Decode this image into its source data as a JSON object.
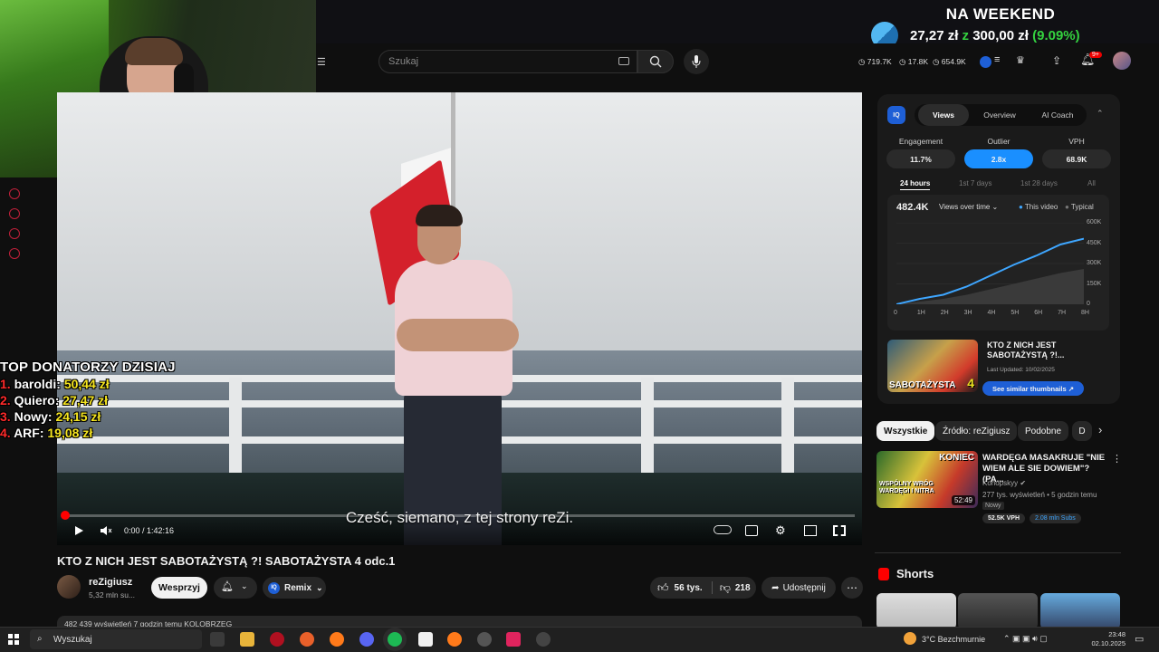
{
  "donation_goal": {
    "title": "NA WEEKEND",
    "amount": "27,27 zł",
    "connector": "z",
    "target": "300,00 zł",
    "percent": "(9.09%)"
  },
  "header": {
    "search_placeholder": "Szukaj",
    "stats": [
      "719.7K",
      "17.8K",
      "654.9K"
    ],
    "notification_count": "9+"
  },
  "donors": {
    "title": "TOP DONATORZY DZISIAJ",
    "list": [
      {
        "rank": "1.",
        "name": "baroldi:",
        "amount": "50,44 zł"
      },
      {
        "rank": "2.",
        "name": "Quiero:",
        "amount": "27,47 zł"
      },
      {
        "rank": "3.",
        "name": "Nowy:",
        "amount": "24,15 zł"
      },
      {
        "rank": "4.",
        "name": "ARF:",
        "amount": "19,08 zł"
      }
    ]
  },
  "player": {
    "subtitle": "Cześć, siemano, z tej strony reZi.",
    "time": "0:00 / 1:42:16",
    "progress": 0.0
  },
  "video": {
    "title": "KTO Z NICH JEST SABOTAŻYSTĄ ?! SABOTAŻYSTA 4 odc.1",
    "channel": "reZigiusz",
    "subscribers": "5,32 mln su...",
    "support_label": "Wesprzyj",
    "remix_label": "Remix",
    "likes": "56 tys.",
    "dislikes": "218",
    "share_label": "Udostępnij",
    "description_preview": "482 439 wyświetleń  7 godzin temu  KOLOBRZEG"
  },
  "vidiq": {
    "logo": "IQ",
    "tabs": [
      "Views",
      "Overview",
      "AI Coach"
    ],
    "active_tab": "Views",
    "metrics": [
      {
        "label": "Engagement",
        "value": "11.7%"
      },
      {
        "label": "Outlier",
        "value": "2.8x"
      },
      {
        "label": "VPH",
        "value": "68.9K"
      }
    ],
    "periods": [
      "24 hours",
      "1st 7 days",
      "1st 28 days",
      "All"
    ],
    "views_total": "482.4K",
    "views_selector": "Views over time",
    "legend_this": "This video",
    "legend_typical": "Typical",
    "similar": {
      "title": "KTO Z NICH JEST SABOTAŻYSTĄ ?!...",
      "updated": "Last Updated: 10/02/2025",
      "thumb_text": "SABOTAŻYSTA",
      "thumb_num": "4",
      "button": "See similar thumbnails"
    }
  },
  "chart_data": {
    "type": "area",
    "x": [
      "0",
      "1H",
      "2H",
      "3H",
      "4H",
      "5H",
      "6H",
      "7H",
      "8H"
    ],
    "y_ticks": [
      "600K",
      "450K",
      "300K",
      "150K",
      "0"
    ],
    "ylim": [
      0,
      600000
    ],
    "series": [
      {
        "name": "This video",
        "values": [
          0,
          40000,
          70000,
          130000,
          210000,
          290000,
          360000,
          440000,
          482400
        ]
      },
      {
        "name": "Typical",
        "values": [
          0,
          20000,
          40000,
          70000,
          110000,
          150000,
          190000,
          230000,
          260000
        ]
      }
    ],
    "legend": "top-right",
    "grid": true
  },
  "chips": [
    "Wszystkie",
    "Źródło: reZigiusz",
    "Podobne",
    "D"
  ],
  "recommendation": {
    "title": "WARDĘGA MASAKRUJE \"NIE WIEM ALE SIE DOWIEM\"? (PA...",
    "channel": "Konopskyy",
    "meta": "277 tys. wyświetleń • 5 godzin temu",
    "new_badge": "Nowy",
    "vph": "52.5K VPH",
    "subs": "2.08 mln Subs",
    "duration": "52:49",
    "thumb_text_top": "KONIEC",
    "thumb_text_bottom": "WSPÓLNY WRÓG WARDĘGI I NITRA"
  },
  "shorts": {
    "title": "Shorts"
  },
  "taskbar": {
    "search_placeholder": "Wyszukaj",
    "weather": "3°C  Bezchmurnie",
    "time": "23:48",
    "date": "02.10.2025"
  },
  "colors": {
    "accent_blue": "#3ea6ff",
    "vidiq_blue": "#1e5fd6",
    "goal_green": "#34d13f",
    "donor_rank": "#ff2a2a",
    "donor_amount": "#f5e520"
  }
}
